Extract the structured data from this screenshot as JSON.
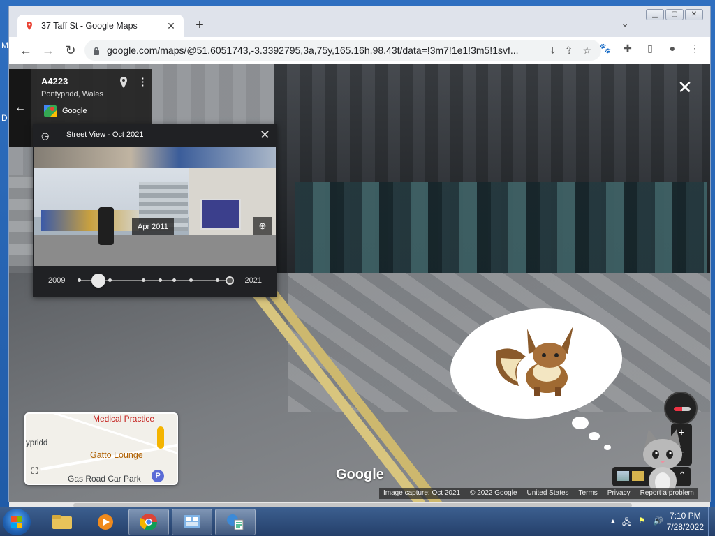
{
  "browser": {
    "tab_title": "37 Taff St - Google Maps",
    "new_tab": "+",
    "url": "google.com/maps/@51.6051743,-3.3392795,3a,75y,165.16h,98.43t/data=!3m7!1e1!3m5!1svf..."
  },
  "address_card": {
    "title": "A4223",
    "subtitle": "Pontypridd, Wales",
    "source": "Google"
  },
  "time_machine": {
    "title": "Street View - Oct 2021",
    "selected_date": "Apr 2011",
    "start_year": "2009",
    "end_year": "2021",
    "selected_fraction": 0.13
  },
  "minimap": {
    "label_medical": "Medical Practice",
    "label_gatto": "Gatto Lounge",
    "label_town": "ypridd",
    "label_parking": "Gas Road Car Park",
    "parking_marker": "P"
  },
  "viewer": {
    "watermark": "Google",
    "footer": {
      "capture": "Image capture: Oct 2021",
      "copyright": "© 2022 Google",
      "country": "United States",
      "terms": "Terms",
      "privacy": "Privacy",
      "report": "Report a problem"
    }
  },
  "taskbar": {
    "time": "7:10 PM",
    "date": "7/28/2022"
  },
  "desktop": {
    "frag_m": "M",
    "frag_d": "D"
  },
  "colors": {
    "accent_google_blue": "#1a73e8",
    "maps_red": "#c5221f",
    "maps_orange": "#b06000"
  }
}
